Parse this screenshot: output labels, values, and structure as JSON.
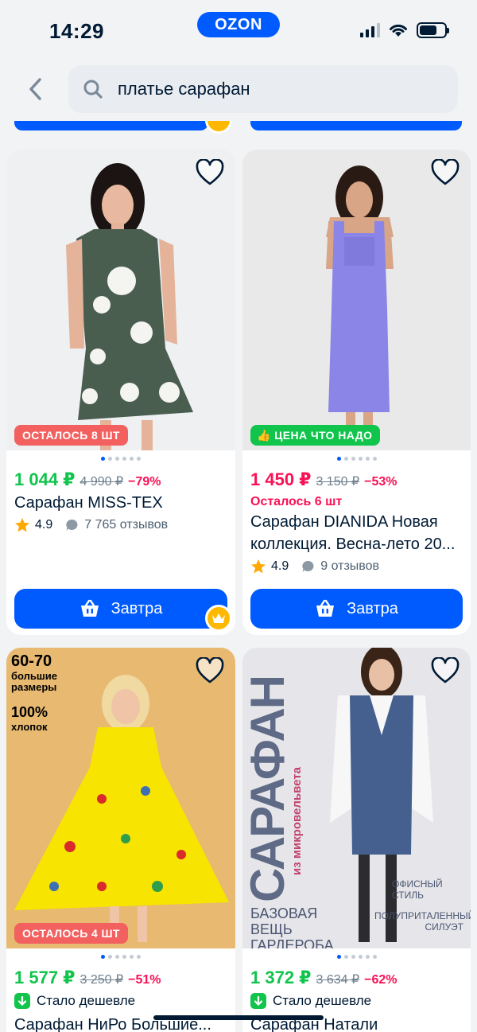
{
  "status": {
    "time": "14:29",
    "brand": "OZON"
  },
  "search": {
    "query": "платье сарафан"
  },
  "products": [
    {
      "badge": "ОСТАЛОСЬ 8 ШТ",
      "badge_color": "#f2615f",
      "price": "1 044 ₽",
      "old_price": "4 990 ₽",
      "discount": "−79%",
      "title": "Сарафан MISS-TEX",
      "rating": "4.9",
      "reviews": "7 765 отзывов",
      "button": "Завтра"
    },
    {
      "badge": "ЦЕНА ЧТО НАДО",
      "badge_color": "#10c44c",
      "price": "1 450 ₽",
      "old_price": "3 150 ₽",
      "discount": "−53%",
      "stock": "Осталось 6 шт",
      "title": "Сарафан DIANIDA Новая коллекция. Весна-лето 20...",
      "rating": "4.9",
      "reviews": "9 отзывов",
      "button": "Завтра"
    },
    {
      "badge": "ОСТАЛОСЬ 4 ШТ",
      "badge_color": "#f2615f",
      "image_text": {
        "size": "60-70",
        "size_sub": "большие размеры",
        "cotton": "100%",
        "cotton_sub": "хлопок"
      },
      "price": "1 577 ₽",
      "old_price": "3 250 ₽",
      "discount": "−51%",
      "cheaper": "Стало дешевле",
      "title": "Сарафан НиРо Большие..."
    },
    {
      "image_text": {
        "big": "САРАФАН",
        "sub": "из микровельвета",
        "office": "ОФИСНЫЙ СТИЛЬ",
        "base": "БАЗОВАЯ ВЕЩЬ ГАРДЕРОБА",
        "fit": "ПОЛУПРИТАЛЕННЫЙ СИЛУЭТ"
      },
      "price": "1 372 ₽",
      "old_price": "3 634 ₽",
      "discount": "−62%",
      "cheaper": "Стало дешевле",
      "title": "Сарафан Натали"
    }
  ],
  "colors": {
    "accent": "#005bff",
    "price_green": "#10c44c",
    "price_pink": "#f91155",
    "star": "#ffa800"
  }
}
